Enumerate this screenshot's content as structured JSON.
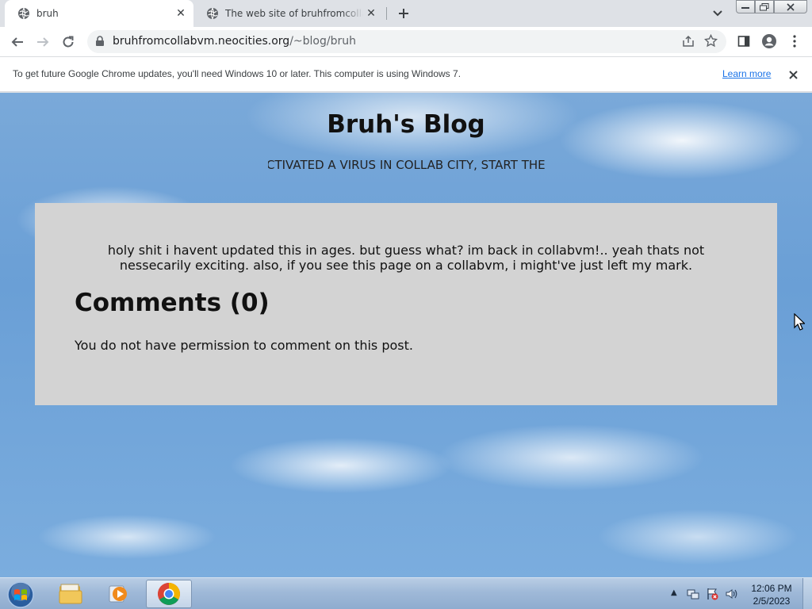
{
  "browser": {
    "tabs": [
      {
        "title": "bruh",
        "active": true
      },
      {
        "title": "The web site of bruhfromcollabvm",
        "active": false
      }
    ],
    "address": {
      "host": "bruhfromcollabvm.neocities.org",
      "path": "/~blog/bruh"
    },
    "infobar": {
      "message": "To get future Google Chrome updates, you'll need Windows 10 or later. This computer is using Windows 7.",
      "link_label": "Learn more"
    }
  },
  "page": {
    "blog_title": "Bruh's Blog",
    "marquee_text": "ACTIVATED A VIRUS IN COLLAB CITY, START THE",
    "post_text": "holy shit i havent updated this in ages. but guess what? im back in collabvm!.. yeah thats not nessecarily exciting. also, if you see this page on a collabvm, i might've just left my mark.",
    "comments_heading": "Comments (0)",
    "comments_note": "You do not have permission to comment on this post."
  },
  "taskbar": {
    "apps": [
      "start-orb",
      "file-explorer",
      "media-player",
      "google-chrome"
    ],
    "clock": {
      "time": "12:06 PM",
      "date": "2/5/2023"
    }
  },
  "colors": {
    "post_box": "#d3d3d3",
    "link": "#1a73e8",
    "tab_strip": "#dee1e6"
  }
}
